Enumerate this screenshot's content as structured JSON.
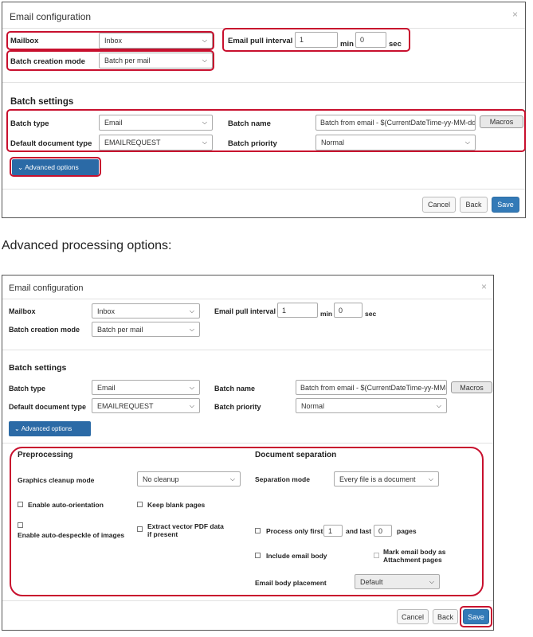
{
  "top": {
    "title": "Email configuration",
    "close": "×",
    "mailbox": {
      "label": "Mailbox",
      "value": "Inbox"
    },
    "batch_creation_mode": {
      "label": "Batch creation mode",
      "value": "Batch per mail"
    },
    "email_pull_interval": {
      "label": "Email pull interval",
      "min_value": "1",
      "min_unit": "min",
      "sec_value": "0",
      "sec_unit": "sec"
    },
    "batch_settings_heading": "Batch settings",
    "batch_type": {
      "label": "Batch type",
      "value": "Email"
    },
    "default_document_type": {
      "label": "Default document type",
      "value": "EMAILREQUEST"
    },
    "batch_name": {
      "label": "Batch name",
      "value": "Batch from email - $(CurrentDateTime-yy-MM-dd-"
    },
    "batch_priority": {
      "label": "Batch priority",
      "value": "Normal"
    },
    "macros_label": "Macros",
    "advanced_options_label": "Advanced options",
    "advanced_options_icon": "chevron-down",
    "cancel_label": "Cancel",
    "back_label": "Back",
    "save_label": "Save"
  },
  "caption": "Advanced processing options:",
  "bottom": {
    "title": "Email configuration",
    "close": "×",
    "mailbox": {
      "label": "Mailbox",
      "value": "Inbox"
    },
    "batch_creation_mode": {
      "label": "Batch creation mode",
      "value": "Batch per mail"
    },
    "email_pull_interval": {
      "label": "Email pull interval",
      "min_value": "1",
      "min_unit": "min",
      "sec_value": "0",
      "sec_unit": "sec"
    },
    "batch_settings_heading": "Batch settings",
    "batch_type": {
      "label": "Batch type",
      "value": "Email"
    },
    "default_document_type": {
      "label": "Default document type",
      "value": "EMAILREQUEST"
    },
    "batch_name": {
      "label": "Batch name",
      "value": "Batch from email - $(CurrentDateTime-yy-MM-dd-"
    },
    "batch_priority": {
      "label": "Batch priority",
      "value": "Normal"
    },
    "macros_label": "Macros",
    "advanced_options_label": "Advanced options",
    "preprocessing": {
      "heading": "Preprocessing",
      "graphics_cleanup": {
        "label": "Graphics cleanup mode",
        "value": "No cleanup"
      },
      "auto_orientation": "Enable auto-orientation",
      "keep_blank_pages": "Keep blank pages",
      "auto_despeckle": "Enable auto-despeckle of images",
      "extract_vector_line1": "Extract vector PDF data",
      "extract_vector_line2": "if present"
    },
    "document_separation": {
      "heading": "Document separation",
      "separation_mode": {
        "label": "Separation mode",
        "value": "Every file is a document"
      },
      "process_only_first": "Process only first",
      "first_value": "1",
      "and_last": "and last",
      "last_value": "0",
      "pages": "pages",
      "include_email_body": "Include email body",
      "mark_body_line1": "Mark email body as",
      "mark_body_line2": "Attachment pages",
      "email_body_placement": {
        "label": "Email body placement",
        "value": "Default"
      }
    },
    "cancel_label": "Cancel",
    "back_label": "Back",
    "save_label": "Save"
  },
  "colors": {
    "highlight": "#c8102e",
    "primary": "#337ab7",
    "advanced": "#2b6aa6"
  }
}
